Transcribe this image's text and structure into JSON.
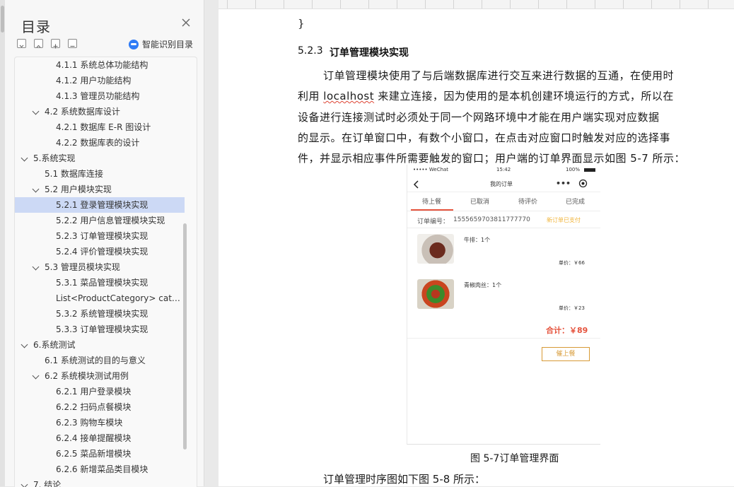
{
  "toc": {
    "title": "目录",
    "smart_label": "智能识别目录",
    "items": [
      {
        "label": "4.1.1  系统总体功能结构",
        "level": 3
      },
      {
        "label": "4.1.2  用户功能结构",
        "level": 3
      },
      {
        "label": "4.1.3  管理员功能结构",
        "level": 3
      },
      {
        "label": "4.2  系统数据库设计",
        "level": 2,
        "expanded": true
      },
      {
        "label": "4.2.1  数据库 E-R 图设计",
        "level": 3
      },
      {
        "label": "4.2.2  数据库表的设计",
        "level": 3
      },
      {
        "label": "5.系统实现",
        "level": 1,
        "expanded": true
      },
      {
        "label": "5.1 数据库连接",
        "level": 2
      },
      {
        "label": "5.2 用户模块实现",
        "level": 2,
        "expanded": true
      },
      {
        "label": "5.2.1  登录管理模块实现",
        "level": 3,
        "selected": true
      },
      {
        "label": "5.2.2  用户信息管理模块实现",
        "level": 3
      },
      {
        "label": "5.2.3  订单管理模块实现",
        "level": 3
      },
      {
        "label": "5.2.4  评价管理模块实现",
        "level": 3
      },
      {
        "label": "5.3  管理员模块实现",
        "level": 2,
        "expanded": true
      },
      {
        "label": "5.3.1  菜品管理模块实现",
        "level": 3
      },
      {
        "label": "List<ProductCategory> cat…",
        "level": 3
      },
      {
        "label": "5.3.2  系统管理模块实现",
        "level": 3
      },
      {
        "label": "5.3.3  订单管理模块实现",
        "level": 3
      },
      {
        "label": "6.系统测试",
        "level": 1,
        "expanded": true
      },
      {
        "label": "6.1 系统测试的目的与意义",
        "level": 2
      },
      {
        "label": "6.2  系统模块测试用例",
        "level": 2,
        "expanded": true
      },
      {
        "label": "6.2.1  用户登录模块",
        "level": 3
      },
      {
        "label": "6.2.2  扫码点餐模块",
        "level": 3
      },
      {
        "label": "6.2.3  购物车模块",
        "level": 3
      },
      {
        "label": "6.2.4  接单提醒模块",
        "level": 3
      },
      {
        "label": "6.2.5  菜品新增模块",
        "level": 3
      },
      {
        "label": "6.2.6  新增菜品类目模块",
        "level": 3
      },
      {
        "label": "7. 结论",
        "level": 1,
        "expanded": true
      }
    ]
  },
  "doc": {
    "brace": "}",
    "section_num": "5.2.3",
    "section_title": "订单管理模块实现",
    "para_lines": [
      "订单管理模块使用了与后端数据库进行交互来进行数据的互通，在使用时",
      "利用 localhost 来建立连接，因为使用的是本机创建环境运行的方式，所以在",
      "设备进行连接测试时必须处于同一个网路环境中才能在用户端实现对应数据",
      "的显示。在订单窗口中，有数个小窗口，在点击对应窗口时触发对应的选择事",
      "件，并显示相应事件所需要触发的窗口；用户端的订单界面显示如图 5-7 所示："
    ],
    "caption": "图 5-7订单管理界面",
    "after_text": "订单管理时序图如下图 5-8 所示："
  },
  "phone": {
    "carrier": "••••• WeChat",
    "time": "15:42",
    "battery": "100%",
    "title": "我的订单",
    "tabs": [
      "待上餐",
      "已取消",
      "待评价",
      "已完成"
    ],
    "order_label": "订单编号：",
    "order_no": "1555659703811777770",
    "order_status": "新订单已支付",
    "items": [
      {
        "name": "牛排：1个",
        "price": "单价：￥66"
      },
      {
        "name": "青椒肉丝：1个",
        "price": "单价：￥23"
      }
    ],
    "total": "合计：￥89",
    "button": "催上餐",
    "accent": "#e5533d"
  }
}
